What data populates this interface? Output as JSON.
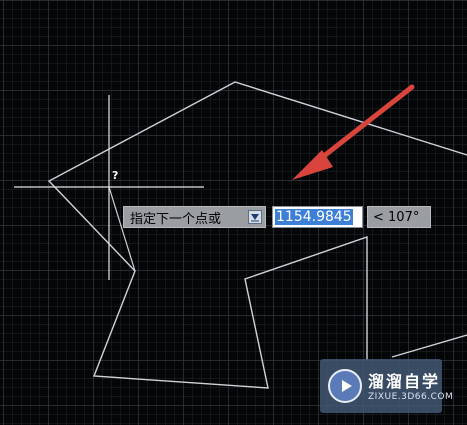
{
  "cursor": {
    "question_mark": "?"
  },
  "dynamic_input": {
    "prompt": "指定下一个点或",
    "distance_value": "1154.9845",
    "angle_value": "< 107°"
  },
  "watermark": {
    "title": "溜溜自学",
    "subtitle": "ZIXUE.3D66.COM"
  },
  "colors": {
    "background": "#050608",
    "polyline": "#cfd3d8",
    "arrow": "#d9453c",
    "selection": "#3d7fd6"
  }
}
